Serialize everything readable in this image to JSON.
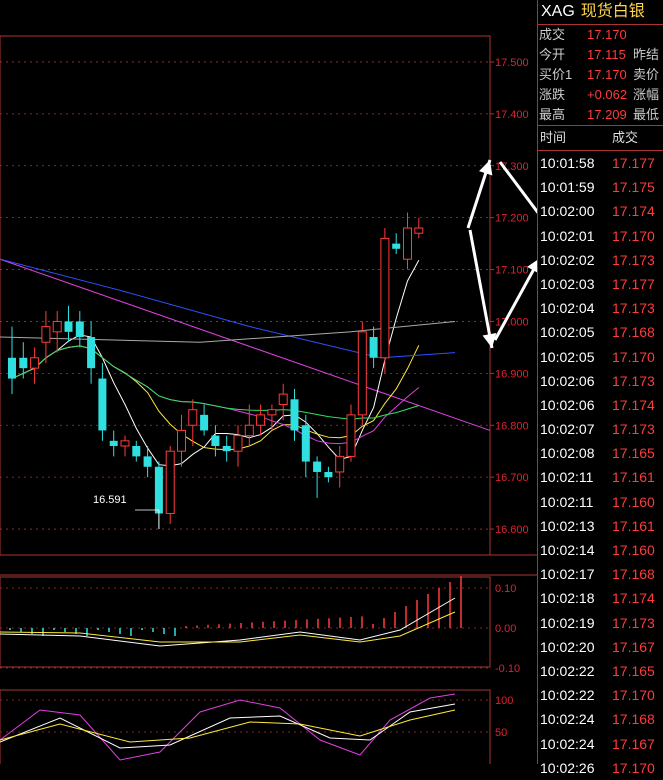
{
  "header": {
    "symbol": "XAG",
    "name": "现货白银"
  },
  "quote": [
    {
      "label": "成交",
      "value": "17.170",
      "label2": ""
    },
    {
      "label": "今开",
      "value": "17.115",
      "label2": "昨结"
    },
    {
      "label": "买价1",
      "value": "17.170",
      "label2": "卖价"
    },
    {
      "label": "涨跌",
      "value": "+0.062",
      "label2": "涨幅"
    },
    {
      "label": "最高",
      "value": "17.209",
      "label2": "最低"
    }
  ],
  "ticks_header": {
    "time": "时间",
    "price": "成交"
  },
  "ticks": [
    {
      "time": "10:01:58",
      "price": "17.177"
    },
    {
      "time": "10:01:59",
      "price": "17.175"
    },
    {
      "time": "10:02:00",
      "price": "17.174"
    },
    {
      "time": "10:02:01",
      "price": "17.170"
    },
    {
      "time": "10:02:02",
      "price": "17.173"
    },
    {
      "time": "10:02:03",
      "price": "17.177"
    },
    {
      "time": "10:02:04",
      "price": "17.173"
    },
    {
      "time": "10:02:05",
      "price": "17.168"
    },
    {
      "time": "10:02:05",
      "price": "17.170"
    },
    {
      "time": "10:02:06",
      "price": "17.173"
    },
    {
      "time": "10:02:06",
      "price": "17.174"
    },
    {
      "time": "10:02:07",
      "price": "17.173"
    },
    {
      "time": "10:02:08",
      "price": "17.165"
    },
    {
      "time": "10:02:11",
      "price": "17.161"
    },
    {
      "time": "10:02:11",
      "price": "17.160"
    },
    {
      "time": "10:02:13",
      "price": "17.161"
    },
    {
      "time": "10:02:14",
      "price": "17.160"
    },
    {
      "time": "10:02:17",
      "price": "17.168"
    },
    {
      "time": "10:02:18",
      "price": "17.174"
    },
    {
      "time": "10:02:19",
      "price": "17.173"
    },
    {
      "time": "10:02:20",
      "price": "17.167"
    },
    {
      "time": "10:02:22",
      "price": "17.165"
    },
    {
      "time": "10:02:22",
      "price": "17.170"
    },
    {
      "time": "10:02:24",
      "price": "17.168"
    },
    {
      "time": "10:02:24",
      "price": "17.167"
    },
    {
      "time": "10:02:26",
      "price": "17.170"
    }
  ],
  "price_axis": [
    "17.500",
    "17.400",
    "17.300",
    "17.200",
    "17.100",
    "17.000",
    "16.900",
    "16.800",
    "16.700",
    "16.600"
  ],
  "macd_axis": [
    "0.10",
    "0.00",
    "-0.10"
  ],
  "kdj_axis": [
    "100",
    "50"
  ],
  "low_marker": "16.591",
  "colors": {
    "up": "#ff3b3b",
    "down": "#30e0e0",
    "grid": "#a33",
    "label": "#d23"
  },
  "chart_data": {
    "type": "candlestick",
    "ylim": [
      16.55,
      17.55
    ],
    "candles": [
      {
        "o": 16.93,
        "h": 16.99,
        "l": 16.86,
        "c": 16.89
      },
      {
        "o": 16.93,
        "h": 16.96,
        "l": 16.89,
        "c": 16.91
      },
      {
        "o": 16.91,
        "h": 16.95,
        "l": 16.88,
        "c": 16.93
      },
      {
        "o": 16.96,
        "h": 17.02,
        "l": 16.92,
        "c": 16.99
      },
      {
        "o": 16.98,
        "h": 17.02,
        "l": 16.94,
        "c": 17.0
      },
      {
        "o": 17.0,
        "h": 17.03,
        "l": 16.96,
        "c": 16.98
      },
      {
        "o": 17.0,
        "h": 17.02,
        "l": 16.95,
        "c": 16.97
      },
      {
        "o": 16.97,
        "h": 17.0,
        "l": 16.88,
        "c": 16.91
      },
      {
        "o": 16.89,
        "h": 16.92,
        "l": 16.77,
        "c": 16.79
      },
      {
        "o": 16.77,
        "h": 16.79,
        "l": 16.74,
        "c": 16.76
      },
      {
        "o": 16.76,
        "h": 16.78,
        "l": 16.74,
        "c": 16.77
      },
      {
        "o": 16.76,
        "h": 16.77,
        "l": 16.73,
        "c": 16.74
      },
      {
        "o": 16.74,
        "h": 16.76,
        "l": 16.7,
        "c": 16.72
      },
      {
        "o": 16.72,
        "h": 16.73,
        "l": 16.6,
        "c": 16.63
      },
      {
        "o": 16.63,
        "h": 16.76,
        "l": 16.61,
        "c": 16.75
      },
      {
        "o": 16.75,
        "h": 16.82,
        "l": 16.72,
        "c": 16.79
      },
      {
        "o": 16.8,
        "h": 16.85,
        "l": 16.76,
        "c": 16.83
      },
      {
        "o": 16.82,
        "h": 16.84,
        "l": 16.78,
        "c": 16.79
      },
      {
        "o": 16.78,
        "h": 16.8,
        "l": 16.74,
        "c": 16.76
      },
      {
        "o": 16.76,
        "h": 16.78,
        "l": 16.73,
        "c": 16.75
      },
      {
        "o": 16.75,
        "h": 16.8,
        "l": 16.72,
        "c": 16.78
      },
      {
        "o": 16.78,
        "h": 16.84,
        "l": 16.76,
        "c": 16.8
      },
      {
        "o": 16.8,
        "h": 16.84,
        "l": 16.78,
        "c": 16.82
      },
      {
        "o": 16.82,
        "h": 16.84,
        "l": 16.79,
        "c": 16.83
      },
      {
        "o": 16.84,
        "h": 16.88,
        "l": 16.81,
        "c": 16.86
      },
      {
        "o": 16.85,
        "h": 16.87,
        "l": 16.77,
        "c": 16.79
      },
      {
        "o": 16.8,
        "h": 16.82,
        "l": 16.7,
        "c": 16.73
      },
      {
        "o": 16.73,
        "h": 16.74,
        "l": 16.66,
        "c": 16.71
      },
      {
        "o": 16.71,
        "h": 16.72,
        "l": 16.69,
        "c": 16.7
      },
      {
        "o": 16.71,
        "h": 16.76,
        "l": 16.68,
        "c": 16.74
      },
      {
        "o": 16.74,
        "h": 16.84,
        "l": 16.73,
        "c": 16.82
      },
      {
        "o": 16.82,
        "h": 17.0,
        "l": 16.8,
        "c": 16.98
      },
      {
        "o": 16.97,
        "h": 16.99,
        "l": 16.91,
        "c": 16.93
      },
      {
        "o": 16.93,
        "h": 17.18,
        "l": 16.9,
        "c": 17.16
      },
      {
        "o": 17.15,
        "h": 17.17,
        "l": 17.13,
        "c": 17.14
      },
      {
        "o": 17.12,
        "h": 17.21,
        "l": 17.1,
        "c": 17.18
      },
      {
        "o": 17.17,
        "h": 17.2,
        "l": 17.16,
        "c": 17.18
      }
    ]
  }
}
